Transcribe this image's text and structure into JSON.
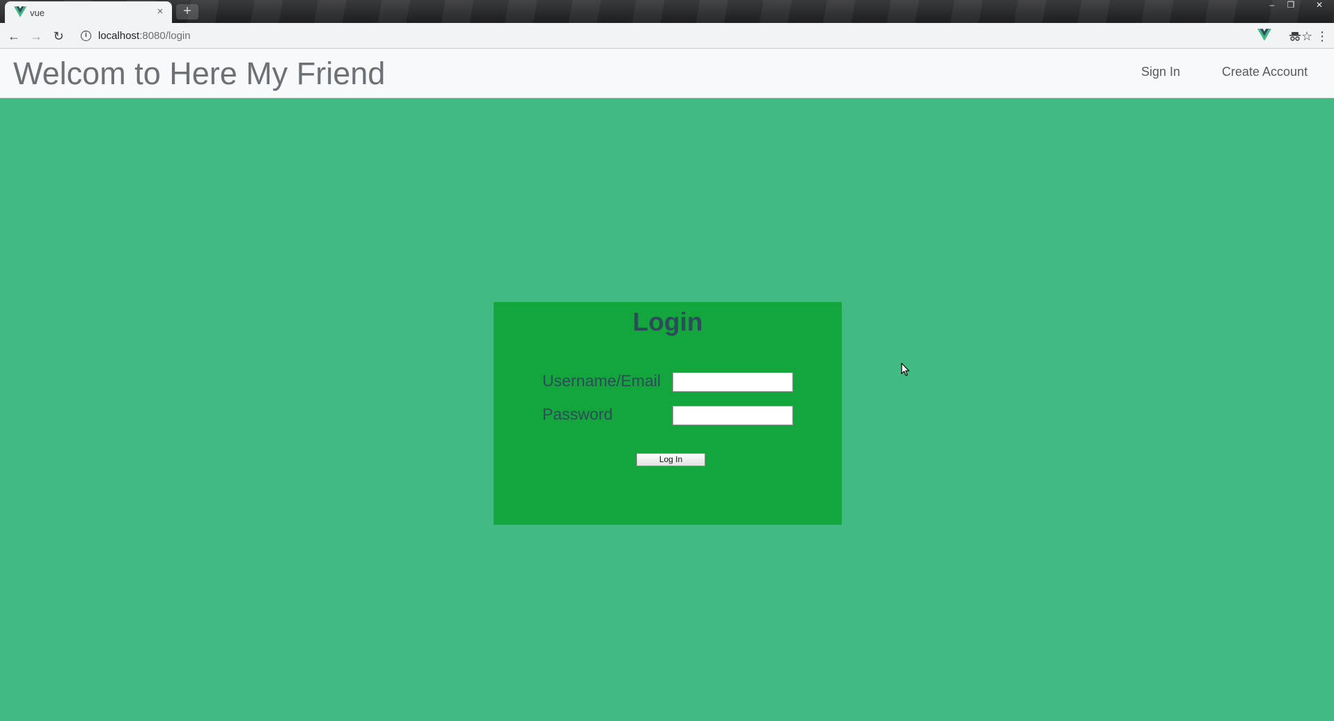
{
  "browser": {
    "tab_title": "vue",
    "tab_close": "×",
    "new_tab": "+",
    "window_controls": {
      "minimize": "–",
      "maximize": "❐",
      "close": "✕"
    },
    "nav": {
      "back": "←",
      "forward": "→",
      "reload": "↻"
    },
    "url_host": "localhost",
    "url_path": ":8080/login",
    "info_icon": "i",
    "bookmark_star": "☆",
    "menu": "⋮",
    "accent_color": "#42b883"
  },
  "navbar": {
    "brand": "Welcom to Here My Friend",
    "links": [
      {
        "label": "Sign In"
      },
      {
        "label": "Create Account"
      }
    ]
  },
  "login": {
    "title": "Login",
    "username_label": "Username/Email",
    "username_value": "",
    "password_label": "Password",
    "password_value": "",
    "submit_label": "Log In",
    "card_color": "#13a63d",
    "page_color": "#41ba84"
  }
}
